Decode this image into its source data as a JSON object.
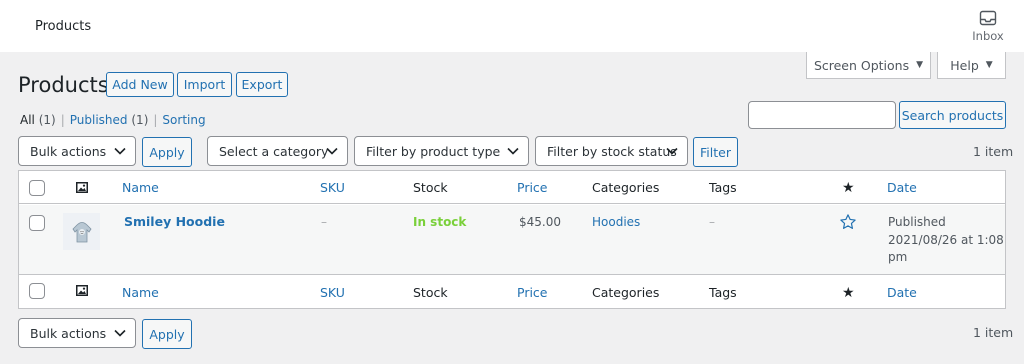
{
  "topbar": {
    "title": "Products",
    "inbox_label": "Inbox"
  },
  "screen_meta": {
    "screen_options": "Screen Options",
    "help": "Help"
  },
  "page": {
    "heading": "Products",
    "add_new": "Add New",
    "import": "Import",
    "export": "Export"
  },
  "subsubsub": {
    "all": "All",
    "all_count": "(1)",
    "published": "Published",
    "published_count": "(1)",
    "sorting": "Sorting"
  },
  "search": {
    "value": "",
    "placeholder": "",
    "button": "Search products"
  },
  "tablenav_top": {
    "bulk_actions": "Bulk actions",
    "apply": "Apply",
    "category": "Select a category",
    "product_type": "Filter by product type",
    "stock_status": "Filter by stock status",
    "filter": "Filter",
    "count": "1 item"
  },
  "tablenav_bottom": {
    "bulk_actions": "Bulk actions",
    "apply": "Apply",
    "count": "1 item"
  },
  "columns": {
    "name": "Name",
    "sku": "SKU",
    "stock": "Stock",
    "price": "Price",
    "categories": "Categories",
    "tags": "Tags",
    "date": "Date",
    "image_icon": "image-icon",
    "featured_icon": "star-filled-icon"
  },
  "rows": [
    {
      "name": "Smiley Hoodie",
      "sku": "–",
      "stock": "In stock",
      "price": "$45.00",
      "categories": "Hoodies",
      "tags": "–",
      "date_status": "Published",
      "date_line1": "2021/08/26 at 1:08",
      "date_line2": "pm",
      "featured_icon": "star-outline-icon"
    }
  ],
  "colors": {
    "link": "#2271b1",
    "in_stock": "#7ad03a",
    "border": "#c3c4c7",
    "background": "#f0f0f1"
  }
}
